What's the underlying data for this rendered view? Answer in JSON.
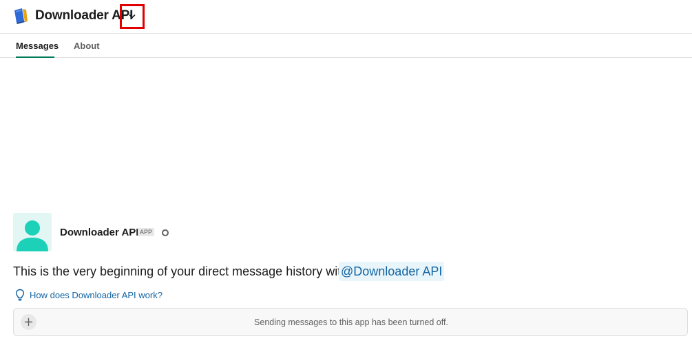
{
  "header": {
    "title": "Downloader API",
    "app_icon": "book-icon",
    "dropdown_icon": "chevron-down-icon"
  },
  "tabs": [
    {
      "label": "Messages",
      "active": true
    },
    {
      "label": "About",
      "active": false
    }
  ],
  "intro": {
    "name": "Downloader API",
    "badge": "APP",
    "text": "This is the very beginning of your direct message history with",
    "mention": "@Downloader API",
    "help_link": "How does Downloader API work?"
  },
  "composer": {
    "message": "Sending messages to this app has been turned off."
  },
  "colors": {
    "accent": "#007a5a",
    "link": "#1264a3",
    "avatar": "#1dd1b8",
    "highlight": "#e00000"
  }
}
